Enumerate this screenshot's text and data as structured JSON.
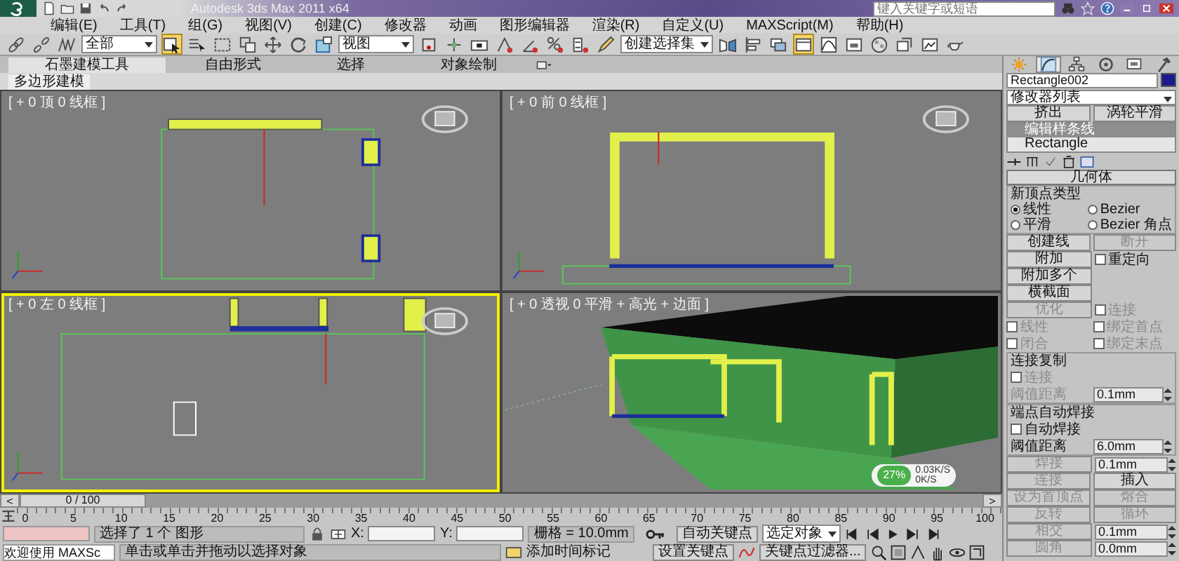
{
  "window": {
    "title": "Autodesk 3ds Max 2011 x64",
    "search_placeholder": "键入关键字或短语"
  },
  "menu": [
    "编辑(E)",
    "工具(T)",
    "组(G)",
    "视图(V)",
    "创建(C)",
    "修改器",
    "动画",
    "图形编辑器",
    "渲染(R)",
    "自定义(U)",
    "MAXScript(M)",
    "帮助(H)"
  ],
  "toolbar": [
    {
      "kind": "link",
      "selected": false
    },
    {
      "kind": "unlink",
      "selected": false
    },
    {
      "kind": "bind",
      "selected": false
    },
    {
      "kind": "dropdown",
      "value": "全部"
    },
    {
      "kind": "select",
      "selected": true
    },
    {
      "kind": "select-name",
      "selected": false
    },
    {
      "kind": "region",
      "selected": false
    },
    {
      "kind": "crossing",
      "selected": false
    },
    {
      "kind": "move",
      "selected": false
    },
    {
      "kind": "rotate",
      "selected": false
    },
    {
      "kind": "scale",
      "selected": false
    },
    {
      "kind": "dropdown",
      "value": "视图"
    },
    {
      "kind": "pivot",
      "selected": false
    },
    {
      "kind": "manipulate",
      "selected": false
    },
    {
      "kind": "keyboard",
      "selected": false
    },
    {
      "kind": "snap",
      "selected": false
    },
    {
      "kind": "angle-snap",
      "selected": false
    },
    {
      "kind": "percent-snap",
      "selected": false
    },
    {
      "kind": "spinner-snap",
      "selected": false
    },
    {
      "kind": "named-sets",
      "selected": false
    },
    {
      "kind": "dropdown",
      "value": "创建选择集"
    },
    {
      "kind": "mirror",
      "selected": false
    },
    {
      "kind": "align",
      "selected": false
    },
    {
      "kind": "layers",
      "selected": false
    },
    {
      "kind": "ribbon",
      "selected": true
    },
    {
      "kind": "curve-editor",
      "selected": false
    },
    {
      "kind": "schematic",
      "selected": false
    },
    {
      "kind": "material",
      "selected": false
    },
    {
      "kind": "render-setup",
      "selected": false
    },
    {
      "kind": "frame-window",
      "selected": false
    },
    {
      "kind": "render",
      "selected": false
    }
  ],
  "ribbon": {
    "tabs": [
      {
        "label": "石墨建模工具",
        "selected": true
      },
      {
        "label": "自由形式",
        "selected": false
      },
      {
        "label": "选择",
        "selected": false
      },
      {
        "label": "对象绘制",
        "selected": false
      }
    ],
    "subtab": "多边形建模"
  },
  "viewports": [
    {
      "kind": "top",
      "label": "[ + 0 顶 0 线框 ]",
      "active": false
    },
    {
      "kind": "front",
      "label": "[ + 0 前 0 线框 ]",
      "active": false
    },
    {
      "kind": "left",
      "label": "[ + 0 左 0 线框 ]",
      "active": true
    },
    {
      "kind": "perspective",
      "label": "[ + 0 透视 0 平滑 + 高光 + 边面 ]",
      "active": false
    }
  ],
  "performance": {
    "percent": "27%",
    "upload": "0.03K/S",
    "download": "0K/S"
  },
  "command_panel": {
    "tabs": [
      {
        "kind": "create",
        "selected": false
      },
      {
        "kind": "modify",
        "selected": true
      },
      {
        "kind": "hierarchy",
        "selected": false
      },
      {
        "kind": "motion",
        "selected": false
      },
      {
        "kind": "display",
        "selected": false
      },
      {
        "kind": "utilities",
        "selected": false
      }
    ],
    "object_name": "Rectangle002",
    "modifier_list": "修改器列表",
    "quick_buttons": [
      "挤出",
      "涡轮平滑"
    ],
    "stack": [
      {
        "label": "编辑样条线",
        "selected": true
      },
      {
        "label": "Rectangle",
        "selected": false
      }
    ],
    "rollout": "几何体",
    "vertex_type": {
      "title": "新顶点类型",
      "options": [
        {
          "label": "线性",
          "selected": true
        },
        {
          "label": "Bezier",
          "selected": false
        },
        {
          "label": "平滑",
          "selected": false
        },
        {
          "label": "Bezier 角点",
          "selected": false
        }
      ]
    },
    "sections": [
      {
        "kind": "rows",
        "rows": [
          [
            {
              "kind": "button",
              "label": "创建线",
              "disabled": false
            },
            {
              "kind": "button",
              "label": "断开",
              "disabled": true
            }
          ],
          [
            {
              "kind": "button",
              "label": "附加",
              "disabled": false
            },
            {
              "kind": "checkbox",
              "label": "重定向",
              "checked": false,
              "disabled": false
            }
          ],
          [
            {
              "kind": "button",
              "label": "附加多个",
              "disabled": false
            }
          ],
          [
            {
              "kind": "button",
              "label": "横截面",
              "disabled": false
            }
          ],
          [
            {
              "kind": "button",
              "label": "优化",
              "disabled": true
            },
            {
              "kind": "checkbox",
              "label": "连接",
              "checked": false,
              "disabled": true
            }
          ],
          [
            {
              "kind": "checkbox",
              "label": "线性",
              "checked": false,
              "disabled": true
            },
            {
              "kind": "checkbox",
              "label": "绑定首点",
              "checked": false,
              "disabled": true
            }
          ],
          [
            {
              "kind": "checkbox",
              "label": "闭合",
              "checked": false,
              "disabled": true
            },
            {
              "kind": "checkbox",
              "label": "绑定末点",
              "checked": false,
              "disabled": true
            }
          ]
        ]
      },
      {
        "kind": "group",
        "title": "连接复制",
        "rows": [
          [
            {
              "kind": "checkbox",
              "label": "连接",
              "checked": false,
              "disabled": true
            }
          ],
          [
            {
              "kind": "text",
              "label": "阈值距离",
              "disabled": true
            },
            {
              "kind": "spinner",
              "value": "0.1mm"
            }
          ]
        ]
      },
      {
        "kind": "group",
        "title": "端点自动焊接",
        "rows": [
          [
            {
              "kind": "checkbox",
              "label": "自动焊接",
              "checked": false,
              "disabled": false
            }
          ],
          [
            {
              "kind": "text",
              "label": "阈值距离",
              "disabled": false
            },
            {
              "kind": "spinner",
              "value": "6.0mm"
            }
          ]
        ]
      },
      {
        "kind": "rows",
        "rows": [
          [
            {
              "kind": "button",
              "label": "焊接",
              "disabled": true
            },
            {
              "kind": "spinner",
              "value": "0.1mm"
            }
          ],
          [
            {
              "kind": "button",
              "label": "连接",
              "disabled": true
            },
            {
              "kind": "button",
              "label": "插入",
              "disabled": false
            }
          ],
          [
            {
              "kind": "button",
              "label": "设为首顶点",
              "disabled": true
            },
            {
              "kind": "button",
              "label": "熔合",
              "disabled": true
            }
          ],
          [
            {
              "kind": "button",
              "label": "反转",
              "disabled": true
            },
            {
              "kind": "button",
              "label": "循环",
              "disabled": true
            }
          ],
          [
            {
              "kind": "button",
              "label": "相交",
              "disabled": true
            },
            {
              "kind": "spinner",
              "value": "0.1mm"
            }
          ],
          [
            {
              "kind": "button",
              "label": "圆角",
              "disabled": true
            },
            {
              "kind": "spinner",
              "value": "0.0mm"
            }
          ]
        ]
      }
    ]
  },
  "time_slider": {
    "position": "0 / 100",
    "level": 0,
    "prev": "<",
    "next": ">"
  },
  "ruler_ticks": [
    "0",
    "5",
    "10",
    "15",
    "20",
    "25",
    "30",
    "35",
    "40",
    "45",
    "50",
    "55",
    "60",
    "65",
    "70",
    "75",
    "80",
    "85",
    "90",
    "95",
    "100"
  ],
  "status": {
    "listener_output": "欢迎使用 MAXSc",
    "prompt": "选择了 1 个 图形",
    "hint": "单击或单击并拖动以选择对象",
    "x_label": "X:",
    "y_label": "Y:",
    "grid": "栅格 = 10.0mm",
    "time_tag": "添加时间标记",
    "auto_key": "自动关键点",
    "key_target": "选定对象",
    "set_key": "设置关键点",
    "key_filters": "关键点过滤器..."
  }
}
